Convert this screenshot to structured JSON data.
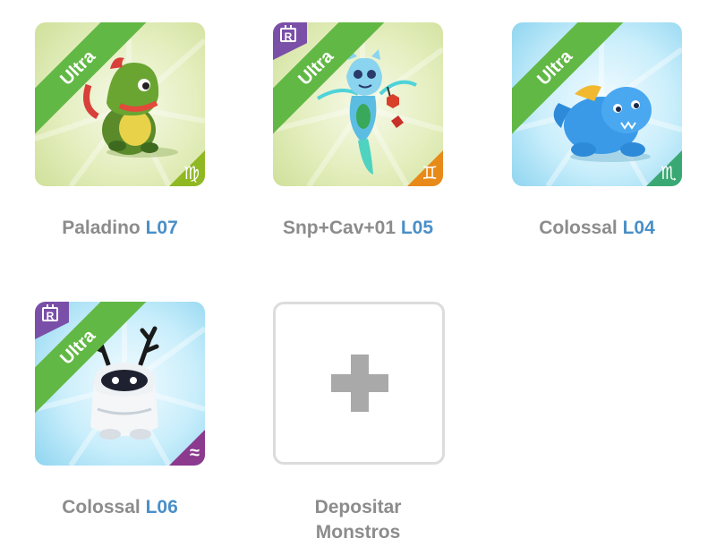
{
  "cards": [
    {
      "ribbon": "Ultra",
      "name": "Paladino",
      "level": "L07",
      "zodiac": "♍",
      "zodiac_color": "#8fb822",
      "rare": false
    },
    {
      "ribbon": "Ultra",
      "name": "Snp+Cav+01",
      "level": "L05",
      "zodiac": "♊",
      "zodiac_color": "#e88a1a",
      "rare": true
    },
    {
      "ribbon": "Ultra",
      "name": "Colossal",
      "level": "L04",
      "zodiac": "♏",
      "zodiac_color": "#3aa873",
      "rare": false
    },
    {
      "ribbon": "Ultra",
      "name": "Colossal",
      "level": "L06",
      "zodiac": "≈",
      "zodiac_color": "#8b3a8e",
      "rare": true
    }
  ],
  "rare_badge": "R",
  "deposit": {
    "line1": "Depositar",
    "line2": "Monstros"
  },
  "colors": {
    "ribbon": "#62b845",
    "level": "#4a8fc8",
    "label": "#8c8c8c",
    "rare": "#7a4fa8"
  }
}
